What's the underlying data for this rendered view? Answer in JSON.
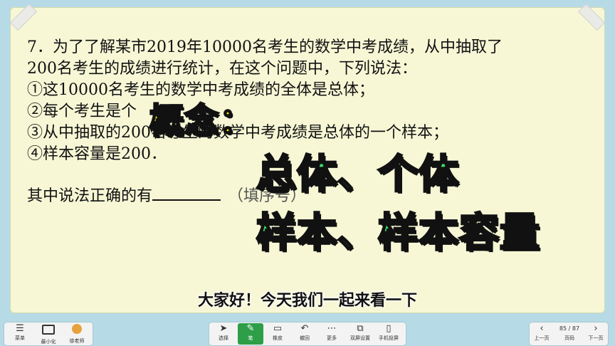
{
  "problem": {
    "line1": "7．为了了解某市2019年10000名考生的数学中考成绩，从中抽取了",
    "line2": "200名考生的成绩进行统计，在这个问题中，下列说法：",
    "line3": "①这10000名考生的数学中考成绩的全体是总体；",
    "line4": "②每个考生是个",
    "line5": "③从中抽取的200名考生的数学中考成绩是总体的一个样本；",
    "line6": "④样本容量是200．",
    "question_prefix": "其中说法正确的有",
    "fill_hint": "（填序号）"
  },
  "overlay": {
    "concept": "概念：",
    "terms_line1": "总体、个体",
    "terms_line2": "样本、样本容量"
  },
  "subtitle": "大家好！今天我们一起来看一下",
  "taskbar": {
    "tray": [
      {
        "icon": "menu-icon",
        "label": "菜单"
      },
      {
        "icon": "minimize-icon",
        "label": "最小化"
      },
      {
        "icon": "teacher-avatar-icon",
        "label": "徐老师"
      }
    ],
    "tools": [
      {
        "icon": "select-cursor-icon",
        "label": "选择"
      },
      {
        "icon": "pen-icon",
        "label": "笔"
      },
      {
        "icon": "eraser-icon",
        "label": "橡皮"
      },
      {
        "icon": "undo-icon",
        "label": "撤回"
      },
      {
        "icon": "more-icon",
        "label": "更多"
      },
      {
        "icon": "split-screen-icon",
        "label": "双屏设置"
      },
      {
        "icon": "phone-cast-icon",
        "label": "手机投屏"
      }
    ],
    "pager": {
      "prev_label": "上一页",
      "page_indicator": "85 / 87",
      "page_label": "页码",
      "next_label": "下一页"
    }
  },
  "colors": {
    "board": "#f7f7d6",
    "background": "#b7dbe6",
    "concept_text": "#f7e300",
    "terms_text": "#39e06a",
    "active_tool": "#2f9e49"
  }
}
